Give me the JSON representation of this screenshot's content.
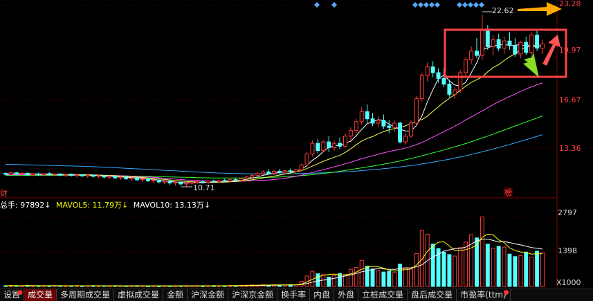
{
  "price_axis": {
    "ticks": [
      "23.28",
      "19.97",
      "16.67",
      "13.36"
    ],
    "tick_values": [
      23.28,
      19.97,
      16.67,
      13.36
    ],
    "color": "#ff3b3b"
  },
  "volume_axis": {
    "ticks": [
      "2797",
      "1398"
    ],
    "unit": "X1000"
  },
  "annotations": {
    "high_price": "22.62",
    "low_price": "10.71",
    "left_tag": "财",
    "right_tag": "榜"
  },
  "volume_header": {
    "total_label": "总手: 97892↓",
    "ma5_label": "MAVOL5: 11.79万↓",
    "ma10_label": "MAVOL10: 13.13万↓",
    "total_color": "#ffffff",
    "ma5_color": "#ffff00",
    "ma10_color": "#ffffff"
  },
  "tabs": [
    {
      "label": "设置",
      "dot": true,
      "active": false
    },
    {
      "label": "成交量",
      "dot": false,
      "active": true
    },
    {
      "label": "多周期成交量",
      "dot": false,
      "active": false
    },
    {
      "label": "虚拟成交量",
      "dot": false,
      "active": false
    },
    {
      "label": "金额",
      "dot": false,
      "active": false
    },
    {
      "label": "沪深金额",
      "dot": false,
      "active": false
    },
    {
      "label": "沪深京金额",
      "dot": false,
      "active": false
    },
    {
      "label": "换手率",
      "dot": false,
      "active": false
    },
    {
      "label": "内盘",
      "dot": false,
      "active": false
    },
    {
      "label": "外盘",
      "dot": false,
      "active": false
    },
    {
      "label": "立桩成交量",
      "dot": false,
      "active": false
    },
    {
      "label": "盘后成交量",
      "dot": false,
      "active": false
    },
    {
      "label": "市盈率(ttm)",
      "dot": true,
      "active": false
    }
  ],
  "colors": {
    "up": "#ff3b3b",
    "down": "#54ffff",
    "ma5": "#ffffff",
    "ma10": "#ffff55",
    "ma20": "#ff55ff",
    "ma60": "#33ff33",
    "ma120": "#33aaff",
    "highlight_box": "#ff4444",
    "arrow_yellow": "#ffaa00",
    "arrow_red": "#ff5555",
    "arrow_green": "#88dd22",
    "event_diamond": "#55aaff"
  },
  "chart_data": {
    "type": "candlestick",
    "ylim": [
      10.3,
      23.4
    ],
    "candles": [
      [
        11.62,
        11.7,
        11.48,
        11.55
      ],
      [
        11.55,
        11.74,
        11.5,
        11.66
      ],
      [
        11.66,
        11.72,
        11.49,
        11.58
      ],
      [
        11.58,
        11.71,
        11.5,
        11.62
      ],
      [
        11.62,
        11.68,
        11.44,
        11.5
      ],
      [
        11.5,
        11.64,
        11.4,
        11.58
      ],
      [
        11.58,
        11.66,
        11.45,
        11.52
      ],
      [
        11.52,
        11.63,
        11.41,
        11.6
      ],
      [
        11.6,
        11.69,
        11.46,
        11.53
      ],
      [
        11.53,
        11.62,
        11.4,
        11.57
      ],
      [
        11.57,
        11.64,
        11.42,
        11.49
      ],
      [
        11.49,
        11.6,
        11.36,
        11.55
      ],
      [
        11.55,
        11.62,
        11.4,
        11.47
      ],
      [
        11.47,
        11.58,
        11.34,
        11.52
      ],
      [
        11.52,
        11.59,
        11.38,
        11.44
      ],
      [
        11.44,
        11.56,
        11.3,
        11.5
      ],
      [
        11.5,
        11.57,
        11.33,
        11.41
      ],
      [
        11.41,
        11.52,
        11.27,
        11.46
      ],
      [
        11.46,
        11.52,
        11.28,
        11.36
      ],
      [
        11.36,
        11.48,
        11.22,
        11.42
      ],
      [
        11.42,
        11.5,
        11.24,
        11.3
      ],
      [
        11.3,
        11.43,
        11.15,
        11.36
      ],
      [
        11.36,
        11.44,
        11.17,
        11.24
      ],
      [
        11.24,
        11.37,
        11.08,
        11.3
      ],
      [
        11.3,
        11.38,
        11.1,
        11.17
      ],
      [
        11.17,
        11.3,
        11.02,
        11.22
      ],
      [
        11.22,
        11.3,
        11.02,
        11.1
      ],
      [
        11.1,
        11.22,
        10.94,
        11.15
      ],
      [
        11.15,
        11.22,
        10.92,
        11.02
      ],
      [
        11.02,
        11.14,
        10.86,
        11.08
      ],
      [
        11.08,
        11.14,
        10.84,
        10.95
      ],
      [
        10.95,
        11.07,
        10.78,
        11.01
      ],
      [
        11.01,
        11.07,
        10.76,
        10.88
      ],
      [
        10.88,
        11.0,
        10.71,
        10.94
      ],
      [
        10.94,
        11.04,
        10.8,
        10.98
      ],
      [
        10.98,
        11.1,
        10.86,
        11.04
      ],
      [
        11.04,
        11.12,
        10.9,
        10.99
      ],
      [
        10.99,
        11.12,
        10.88,
        11.08
      ],
      [
        11.08,
        11.18,
        10.96,
        11.03
      ],
      [
        11.03,
        11.16,
        10.94,
        11.12
      ],
      [
        11.12,
        11.24,
        11.0,
        11.08
      ],
      [
        11.08,
        11.22,
        10.98,
        11.18
      ],
      [
        11.18,
        11.32,
        11.06,
        11.14
      ],
      [
        11.14,
        11.3,
        11.05,
        11.26
      ],
      [
        11.26,
        11.44,
        11.14,
        11.36
      ],
      [
        11.36,
        11.56,
        11.24,
        11.48
      ],
      [
        11.48,
        11.68,
        11.36,
        11.6
      ],
      [
        11.6,
        11.82,
        11.5,
        11.72
      ],
      [
        11.72,
        11.9,
        11.54,
        11.62
      ],
      [
        11.62,
        11.84,
        11.5,
        11.76
      ],
      [
        11.76,
        11.92,
        11.62,
        11.7
      ],
      [
        11.7,
        11.86,
        11.58,
        11.8
      ],
      [
        11.8,
        11.96,
        11.64,
        11.74
      ],
      [
        11.74,
        11.92,
        11.6,
        11.86
      ],
      [
        11.86,
        12.3,
        11.76,
        12.2
      ],
      [
        12.2,
        13.1,
        12.1,
        12.96
      ],
      [
        12.96,
        13.9,
        12.8,
        13.7
      ],
      [
        13.7,
        14.0,
        13.0,
        13.2
      ],
      [
        13.2,
        13.9,
        13.1,
        13.8
      ],
      [
        13.8,
        14.2,
        13.1,
        13.4
      ],
      [
        13.4,
        13.9,
        13.2,
        13.7
      ],
      [
        13.7,
        14.1,
        13.3,
        13.5
      ],
      [
        13.5,
        14.4,
        13.4,
        14.2
      ],
      [
        14.2,
        14.8,
        13.9,
        14.6
      ],
      [
        14.6,
        15.4,
        14.4,
        15.2
      ],
      [
        15.2,
        16.2,
        15.0,
        15.9
      ],
      [
        15.9,
        16.4,
        15.1,
        15.4
      ],
      [
        15.4,
        15.8,
        14.9,
        15.1
      ],
      [
        15.1,
        15.6,
        14.8,
        15.3
      ],
      [
        15.3,
        15.7,
        14.7,
        14.9
      ],
      [
        14.9,
        15.3,
        14.4,
        14.8
      ],
      [
        14.8,
        15.3,
        14.5,
        15.1
      ],
      [
        15.1,
        15.2,
        13.7,
        13.8
      ],
      [
        13.8,
        14.4,
        13.6,
        14.2
      ],
      [
        14.2,
        15.3,
        14.1,
        15.1
      ],
      [
        15.1,
        17.0,
        15.0,
        16.8
      ],
      [
        16.8,
        18.6,
        16.6,
        18.4
      ],
      [
        18.4,
        19.3,
        18.0,
        19.0
      ],
      [
        19.0,
        19.4,
        18.3,
        18.6
      ],
      [
        18.6,
        18.9,
        17.9,
        18.2
      ],
      [
        18.2,
        18.9,
        17.6,
        17.8
      ],
      [
        17.8,
        18.1,
        16.9,
        17.1
      ],
      [
        17.1,
        17.6,
        16.8,
        17.4
      ],
      [
        17.4,
        18.8,
        17.2,
        18.6
      ],
      [
        18.6,
        19.7,
        18.4,
        19.5
      ],
      [
        19.5,
        20.4,
        19.2,
        20.1
      ],
      [
        20.1,
        21.0,
        19.6,
        19.8
      ],
      [
        19.8,
        22.62,
        19.5,
        21.6
      ],
      [
        21.6,
        21.9,
        20.2,
        20.4
      ],
      [
        20.4,
        21.2,
        19.8,
        20.9
      ],
      [
        20.9,
        21.3,
        20.1,
        20.3
      ],
      [
        20.3,
        21.1,
        19.9,
        20.8
      ],
      [
        20.8,
        21.4,
        20.2,
        20.5
      ],
      [
        20.5,
        21.0,
        19.7,
        19.9
      ],
      [
        19.9,
        20.8,
        19.6,
        20.7
      ],
      [
        20.7,
        21.1,
        19.8,
        20.0
      ],
      [
        20.0,
        21.4,
        19.8,
        21.2
      ],
      [
        21.2,
        21.6,
        20.1,
        20.3
      ],
      [
        20.3,
        20.9,
        19.9,
        20.6
      ]
    ],
    "volumes": [
      28,
      42,
      31,
      25,
      36,
      22,
      30,
      27,
      24,
      33,
      29,
      21,
      26,
      35,
      23,
      28,
      32,
      20,
      27,
      24,
      30,
      22,
      26,
      21,
      29,
      25,
      23,
      28,
      20,
      24,
      27,
      22,
      26,
      21,
      25,
      30,
      24,
      28,
      33,
      27,
      31,
      36,
      29,
      40,
      52,
      61,
      48,
      66,
      55,
      70,
      58,
      63,
      74,
      69,
      210,
      420,
      610,
      510,
      470,
      380,
      440,
      520,
      480,
      690,
      760,
      1050,
      820,
      700,
      640,
      580,
      610,
      560,
      900,
      760,
      700,
      1320,
      2250,
      2100,
      1700,
      1520,
      1380,
      1280,
      1220,
      1560,
      1780,
      2080,
      1950,
      2790,
      1700,
      1540,
      1610,
      1580,
      1300,
      1200,
      1240,
      1380,
      1180,
      1420,
      1360
    ],
    "ma5": [
      11.58,
      11.58,
      11.58,
      11.58,
      11.58,
      11.58,
      11.57,
      11.56,
      11.55,
      11.56,
      11.55,
      11.55,
      11.53,
      11.52,
      11.51,
      11.5,
      11.47,
      11.47,
      11.43,
      11.43,
      11.39,
      11.38,
      11.34,
      11.33,
      11.27,
      11.27,
      11.21,
      11.21,
      11.13,
      11.11,
      11.06,
      11.02,
      10.99,
      10.97,
      10.97,
      10.97,
      10.97,
      11.01,
      11.02,
      11.05,
      11.06,
      11.1,
      11.11,
      11.14,
      11.2,
      11.28,
      11.37,
      11.48,
      11.56,
      11.64,
      11.68,
      11.7,
      11.72,
      11.78,
      11.9,
      12.15,
      12.52,
      12.78,
      13.13,
      13.43,
      13.56,
      13.52,
      13.72,
      13.84,
      14.24,
      14.66,
      15.06,
      15.19,
      15.34,
      15.3,
      15.02,
      14.86,
      14.67,
      14.56,
      14.55,
      14.95,
      15.6,
      16.58,
      17.42,
      18.18,
      18.43,
      18.04,
      17.74,
      17.7,
      17.93,
      18.6,
      19.29,
      20.2,
      20.31,
      20.48,
      20.51,
      20.59,
      20.47,
      20.5,
      20.56,
      20.45,
      20.55,
      20.44,
      20.44
    ],
    "ma10": [
      11.57,
      11.57,
      11.57,
      11.57,
      11.57,
      11.57,
      11.57,
      11.57,
      11.57,
      11.57,
      11.56,
      11.56,
      11.55,
      11.54,
      11.53,
      11.53,
      11.51,
      11.5,
      11.48,
      11.47,
      11.45,
      11.43,
      11.41,
      11.38,
      11.35,
      11.33,
      11.3,
      11.27,
      11.23,
      11.2,
      11.16,
      11.12,
      11.09,
      11.05,
      11.04,
      11.02,
      11.0,
      11.0,
      10.99,
      11.0,
      11.01,
      11.03,
      11.05,
      11.08,
      11.12,
      11.17,
      11.23,
      11.3,
      11.37,
      11.43,
      11.5,
      11.57,
      11.65,
      11.72,
      11.8,
      11.95,
      12.12,
      12.28,
      12.46,
      12.6,
      12.74,
      12.86,
      13.07,
      13.32,
      13.6,
      13.86,
      14.04,
      14.17,
      14.35,
      14.52,
      14.64,
      14.73,
      14.8,
      14.91,
      15.07,
      15.25,
      15.35,
      15.59,
      15.92,
      16.23,
      16.55,
      16.82,
      17.08,
      17.37,
      17.67,
      17.93,
      18.11,
      18.3,
      18.66,
      18.96,
      19.16,
      19.44,
      19.7,
      19.9,
      20.18,
      20.38,
      20.4,
      20.44,
      20.48
    ],
    "ma20": [
      11.52,
      11.52,
      11.52,
      11.52,
      11.52,
      11.52,
      11.52,
      11.52,
      11.52,
      11.52,
      11.52,
      11.52,
      11.51,
      11.51,
      11.5,
      11.5,
      11.49,
      11.49,
      11.48,
      11.47,
      11.46,
      11.45,
      11.44,
      11.42,
      11.4,
      11.38,
      11.36,
      11.34,
      11.31,
      11.28,
      11.25,
      11.22,
      11.19,
      11.16,
      11.14,
      11.12,
      11.1,
      11.09,
      11.08,
      11.07,
      11.07,
      11.07,
      11.07,
      11.08,
      11.09,
      11.1,
      11.12,
      11.14,
      11.16,
      11.19,
      11.23,
      11.28,
      11.34,
      11.41,
      11.49,
      11.58,
      11.68,
      11.78,
      11.88,
      11.97,
      12.07,
      12.17,
      12.28,
      12.39,
      12.51,
      12.63,
      12.74,
      12.84,
      12.94,
      13.04,
      13.13,
      13.21,
      13.29,
      13.38,
      13.48,
      13.61,
      13.76,
      13.94,
      14.13,
      14.32,
      14.51,
      14.7,
      14.89,
      15.1,
      15.32,
      15.53,
      15.74,
      15.95,
      16.17,
      16.39,
      16.58,
      16.77,
      16.95,
      17.12,
      17.3,
      17.47,
      17.62,
      17.76,
      17.9
    ],
    "ma60": [
      11.48,
      11.48,
      11.48,
      11.48,
      11.48,
      11.48,
      11.48,
      11.48,
      11.48,
      11.48,
      11.48,
      11.48,
      11.48,
      11.48,
      11.47,
      11.47,
      11.47,
      11.47,
      11.46,
      11.46,
      11.45,
      11.45,
      11.44,
      11.43,
      11.43,
      11.42,
      11.41,
      11.4,
      11.39,
      11.38,
      11.37,
      11.36,
      11.35,
      11.34,
      11.33,
      11.32,
      11.31,
      11.31,
      11.3,
      11.3,
      11.3,
      11.3,
      11.3,
      11.3,
      11.31,
      11.31,
      11.32,
      11.33,
      11.34,
      11.35,
      11.37,
      11.39,
      11.41,
      11.43,
      11.46,
      11.49,
      11.53,
      11.57,
      11.61,
      11.66,
      11.71,
      11.76,
      11.82,
      11.88,
      11.94,
      12.0,
      12.06,
      12.12,
      12.19,
      12.26,
      12.33,
      12.4,
      12.48,
      12.56,
      12.65,
      12.74,
      12.84,
      12.94,
      13.04,
      13.14,
      13.24,
      13.35,
      13.46,
      13.57,
      13.69,
      13.81,
      13.94,
      14.07,
      14.2,
      14.34,
      14.48,
      14.62,
      14.76,
      14.9,
      15.04,
      15.18,
      15.32,
      15.46,
      15.6
    ],
    "ma120": [
      12.25,
      12.24,
      12.23,
      12.22,
      12.21,
      12.2,
      12.19,
      12.18,
      12.17,
      12.16,
      12.15,
      12.14,
      12.13,
      12.12,
      12.11,
      12.09,
      12.08,
      12.06,
      12.05,
      12.03,
      12.01,
      11.99,
      11.97,
      11.95,
      11.93,
      11.91,
      11.89,
      11.87,
      11.85,
      11.83,
      11.81,
      11.79,
      11.77,
      11.75,
      11.73,
      11.71,
      11.69,
      11.67,
      11.66,
      11.64,
      11.63,
      11.62,
      11.61,
      11.6,
      11.59,
      11.59,
      11.58,
      11.58,
      11.58,
      11.58,
      11.58,
      11.59,
      11.59,
      11.6,
      11.61,
      11.62,
      11.63,
      11.64,
      11.66,
      11.67,
      11.69,
      11.71,
      11.73,
      11.75,
      11.78,
      11.81,
      11.84,
      11.87,
      11.9,
      11.94,
      11.98,
      12.02,
      12.06,
      12.11,
      12.16,
      12.21,
      12.27,
      12.33,
      12.39,
      12.46,
      12.53,
      12.6,
      12.68,
      12.76,
      12.84,
      12.93,
      13.02,
      13.11,
      13.21,
      13.31,
      13.41,
      13.51,
      13.62,
      13.73,
      13.84,
      13.95,
      14.06,
      14.18,
      14.3
    ],
    "vol_ma5": [
      30,
      30,
      30,
      30,
      32,
      31,
      29,
      28,
      27,
      28,
      29,
      27,
      27,
      29,
      27,
      27,
      29,
      28,
      26,
      26,
      27,
      25,
      26,
      25,
      26,
      25,
      25,
      26,
      25,
      24,
      25,
      24,
      24,
      24,
      25,
      25,
      25,
      27,
      28,
      28,
      29,
      31,
      32,
      35,
      40,
      46,
      50,
      57,
      57,
      60,
      61,
      62,
      64,
      67,
      95,
      180,
      285,
      380,
      449,
      482,
      496,
      462,
      458,
      502,
      578,
      690,
      764,
      814,
      792,
      737,
      662,
      612,
      658,
      674,
      706,
      862,
      1086,
      1414,
      1618,
      1778,
      1792,
      1628,
      1444,
      1442,
      1480,
      1546,
      1666,
      1974,
      2100,
      2072,
      1870,
      1764,
      1548,
      1448,
      1386,
      1368,
      1300,
      1312,
      1310
    ],
    "vol_ma10": [
      29,
      29,
      29,
      29,
      30,
      30,
      30,
      30,
      30,
      30,
      30,
      29,
      29,
      29,
      28,
      28,
      28,
      28,
      27,
      27,
      28,
      27,
      26,
      26,
      26,
      26,
      26,
      26,
      25,
      25,
      25,
      25,
      25,
      25,
      25,
      25,
      25,
      26,
      26,
      26,
      27,
      28,
      29,
      30,
      33,
      36,
      39,
      44,
      47,
      51,
      55,
      58,
      61,
      64,
      79,
      116,
      173,
      222,
      259,
      289,
      329,
      374,
      420,
      470,
      520,
      590,
      630,
      680,
      720,
      700,
      690,
      690,
      720,
      740,
      750,
      790,
      870,
      1040,
      1180,
      1290,
      1420,
      1470,
      1520,
      1530,
      1580,
      1700,
      1830,
      1900,
      1900,
      1850,
      1780,
      1800,
      1760,
      1710,
      1670,
      1620,
      1560,
      1530,
      1500
    ]
  }
}
